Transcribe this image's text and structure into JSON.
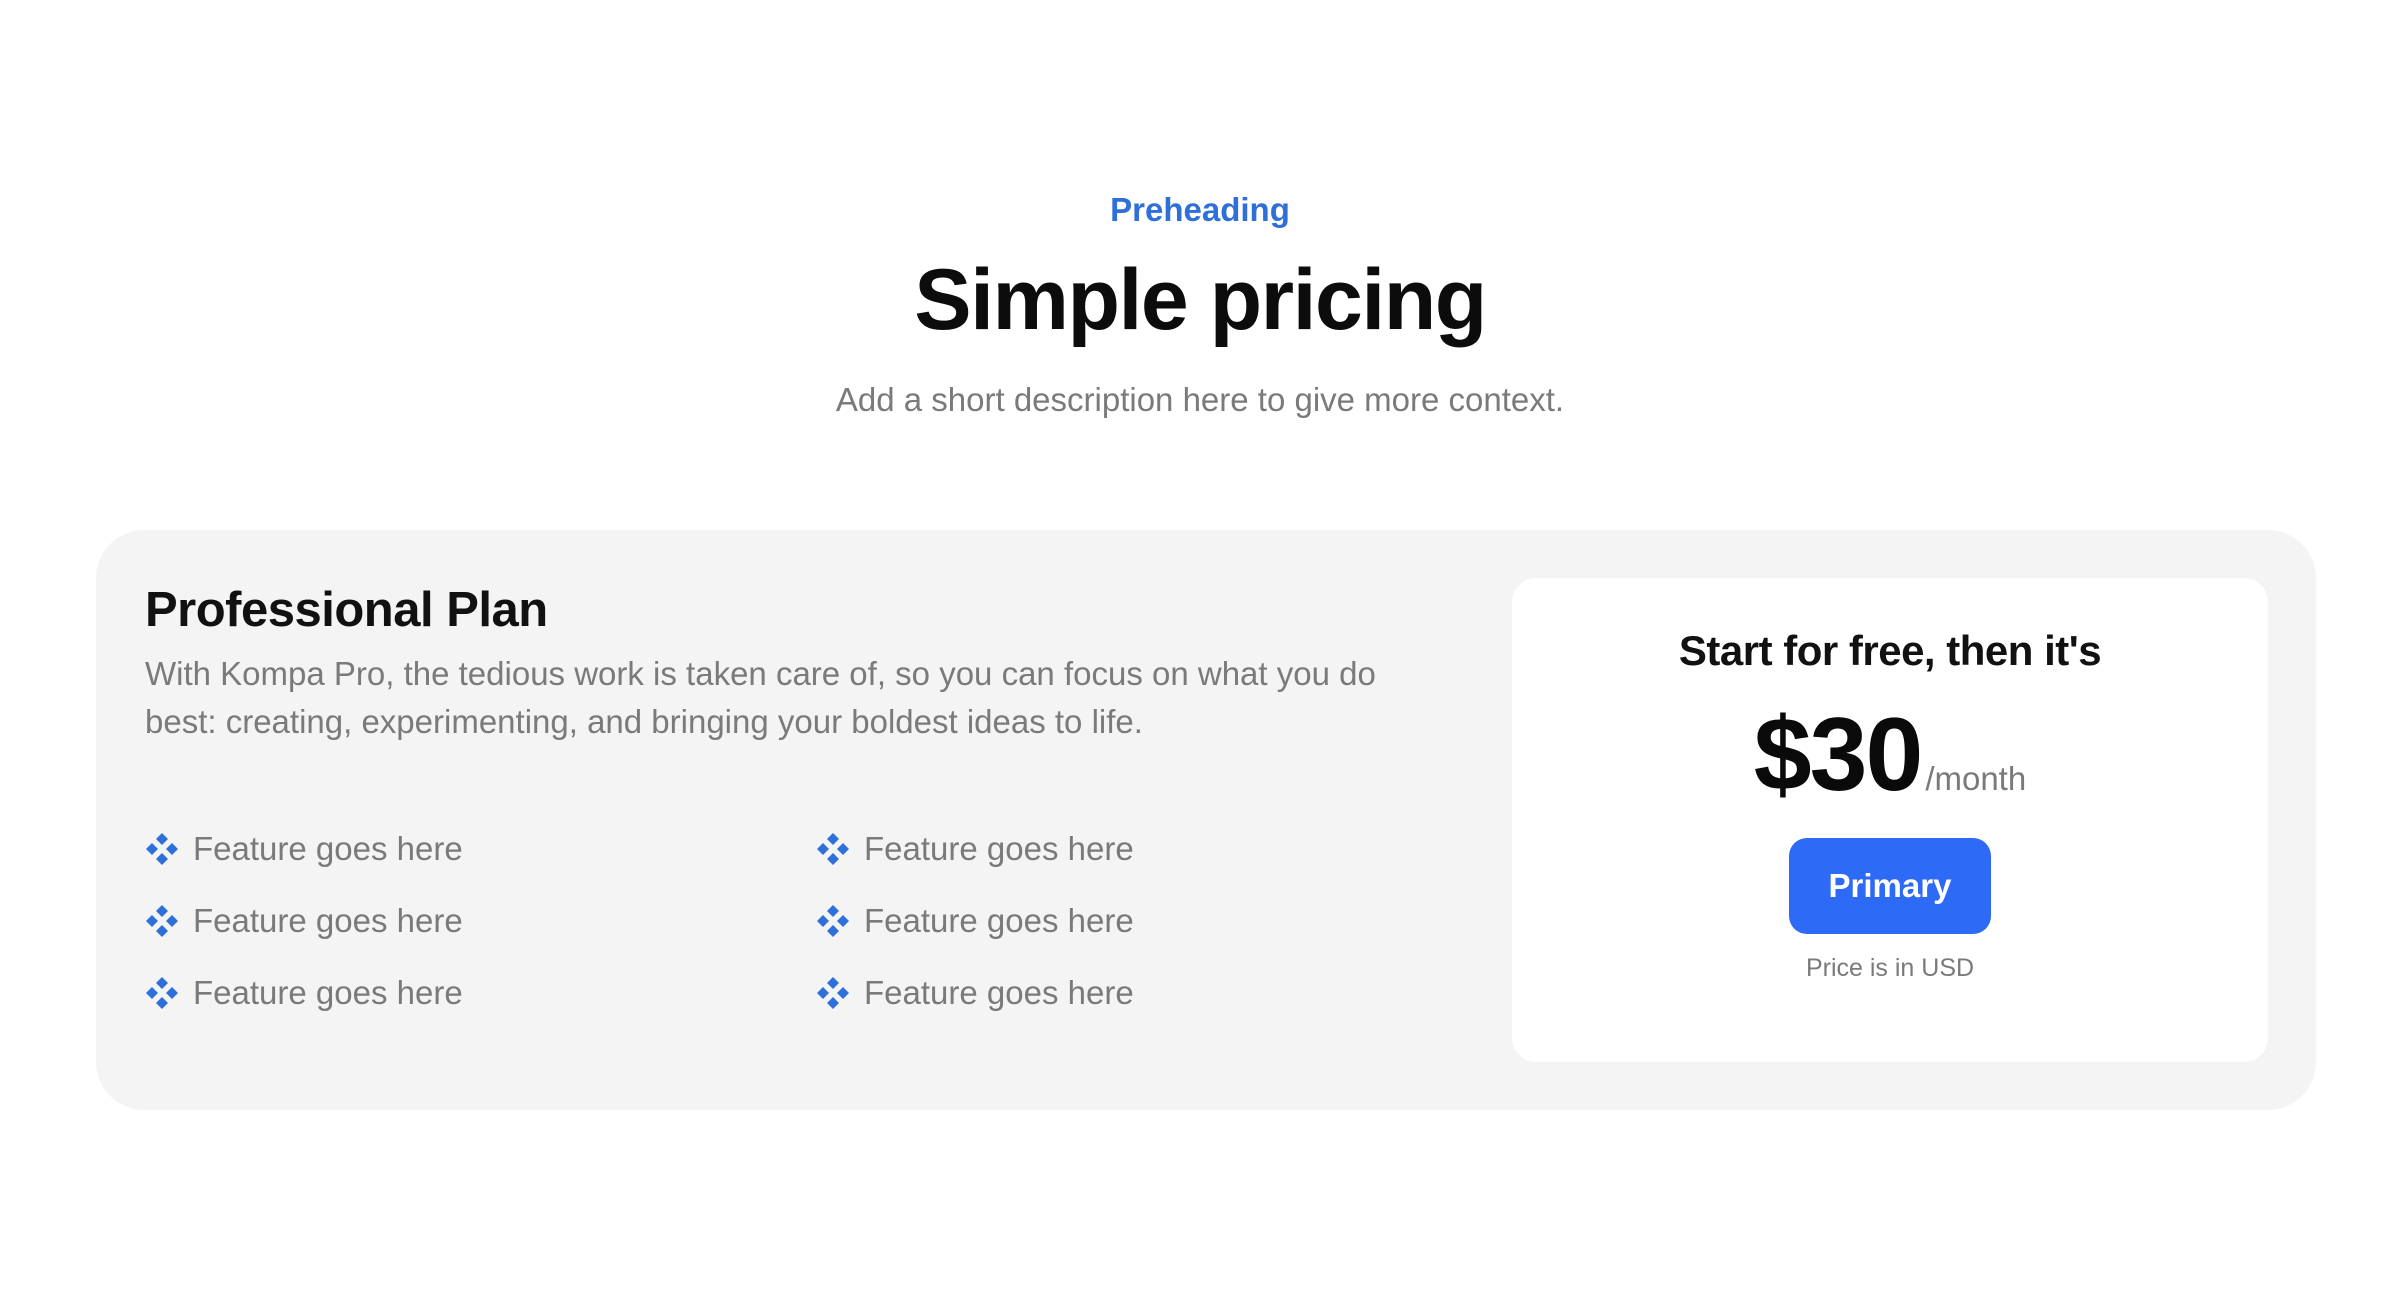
{
  "header": {
    "preheading": "Preheading",
    "title": "Simple pricing",
    "subtitle": "Add a short description here to give more context."
  },
  "plan": {
    "title": "Professional Plan",
    "description_line1": "With Kompa Pro, the tedious work is taken care of, so you can focus on what you do",
    "description_line2": "best: creating, experimenting, and bringing your boldest ideas to life.",
    "feature_icon": "diamond-cluster-icon",
    "features": [
      "Feature goes here",
      "Feature goes here",
      "Feature goes here",
      "Feature goes here",
      "Feature goes here",
      "Feature goes here"
    ]
  },
  "pricing": {
    "lead": "Start for free, then it's",
    "amount": "$30",
    "period": "/month",
    "button_label": "Primary",
    "note": "Price is in USD"
  },
  "colors": {
    "accent": "#2f6fd9",
    "button": "#2d6af6",
    "card_background": "#f4f4f4",
    "muted_text": "#7a7a7a"
  }
}
